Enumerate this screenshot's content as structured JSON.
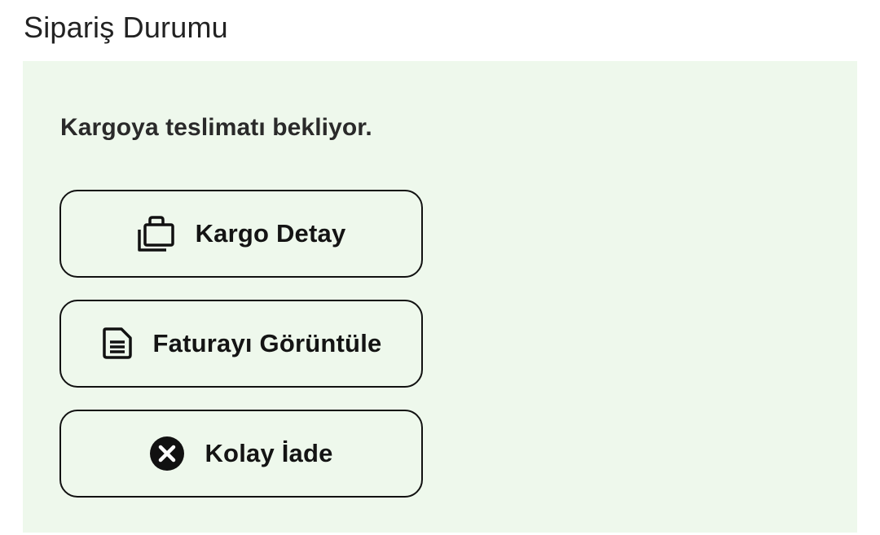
{
  "section": {
    "title": "Sipariş Durumu"
  },
  "status": {
    "message": "Kargoya teslimatı bekliyor.",
    "background_color": "#eef8ec"
  },
  "actions": [
    {
      "label": "Kargo Detay",
      "icon": "luggage-icon"
    },
    {
      "label": "Faturayı Görüntüle",
      "icon": "document-icon"
    },
    {
      "label": "Kolay İade",
      "icon": "cancel-circle-icon"
    }
  ]
}
